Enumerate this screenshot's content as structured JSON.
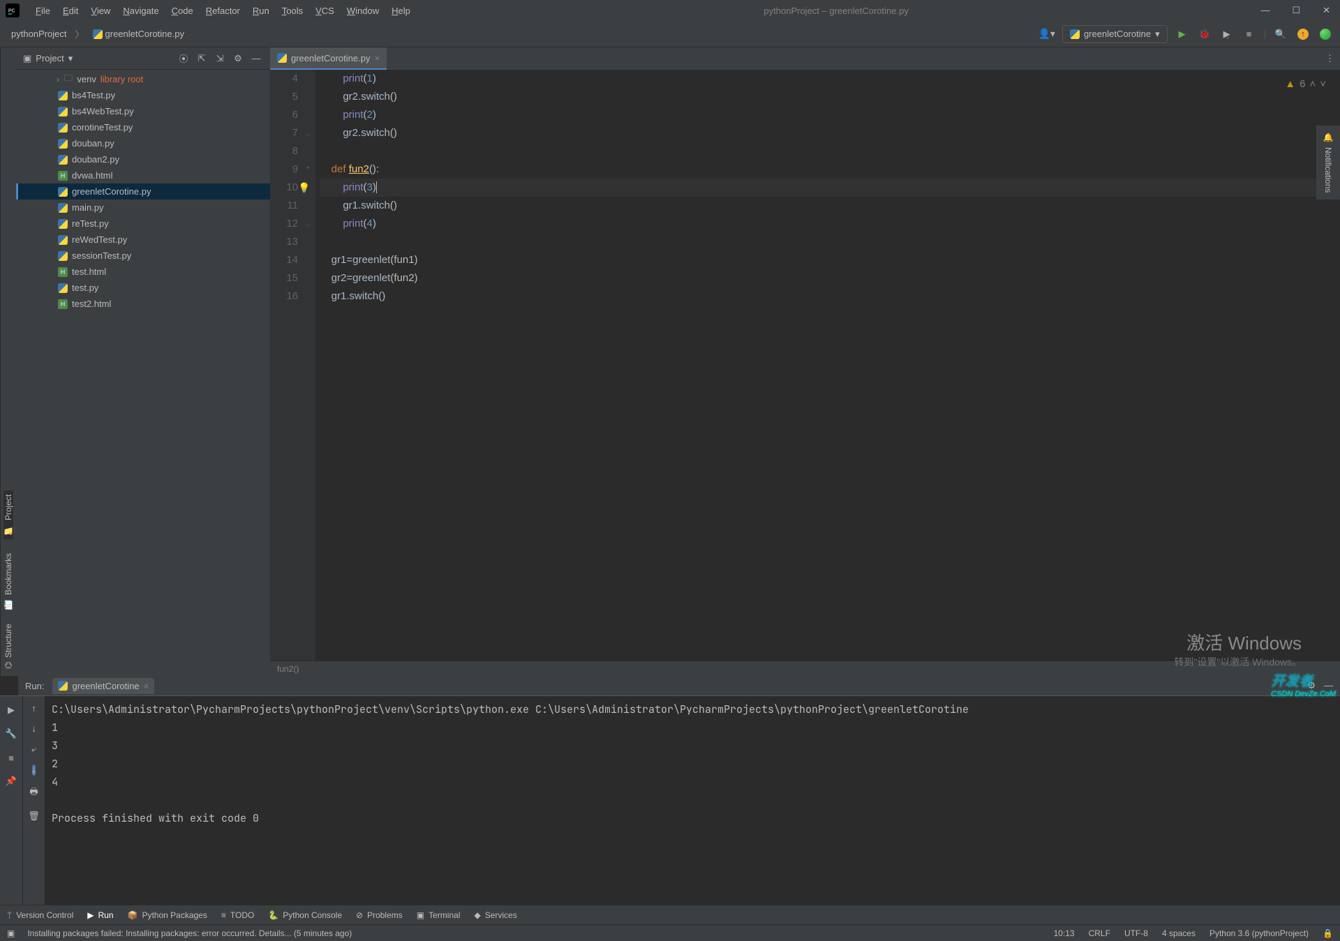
{
  "title": "pythonProject – greenletCorotine.py",
  "menu": [
    "File",
    "Edit",
    "View",
    "Navigate",
    "Code",
    "Refactor",
    "Run",
    "Tools",
    "VCS",
    "Window",
    "Help"
  ],
  "breadcrumb": [
    {
      "label": "pythonProject",
      "icon": ""
    },
    {
      "label": "greenletCorotine.py",
      "icon": "py"
    }
  ],
  "run_config": {
    "icon": "py",
    "label": "greenletCorotine"
  },
  "project_panel": {
    "title": "Project",
    "venv_label": "venv",
    "venv_tag": "library root",
    "files": [
      {
        "name": "bs4Test.py",
        "icon": "py"
      },
      {
        "name": "bs4WebTest.py",
        "icon": "py"
      },
      {
        "name": "corotineTest.py",
        "icon": "py"
      },
      {
        "name": "douban.py",
        "icon": "py"
      },
      {
        "name": "douban2.py",
        "icon": "py"
      },
      {
        "name": "dvwa.html",
        "icon": "html"
      },
      {
        "name": "greenletCorotine.py",
        "icon": "py",
        "selected": true
      },
      {
        "name": "main.py",
        "icon": "py"
      },
      {
        "name": "reTest.py",
        "icon": "py"
      },
      {
        "name": "reWedTest.py",
        "icon": "py"
      },
      {
        "name": "sessionTest.py",
        "icon": "py"
      },
      {
        "name": "test.html",
        "icon": "html"
      },
      {
        "name": "test.py",
        "icon": "py"
      },
      {
        "name": "test2.html",
        "icon": "html"
      }
    ]
  },
  "sidebar_tabs": [
    "Project",
    "Bookmarks",
    "Structure"
  ],
  "editor": {
    "tab_label": "greenletCorotine.py",
    "inspection_count": "6",
    "breadcrumb": "fun2()",
    "lines": [
      4,
      5,
      6,
      7,
      8,
      9,
      10,
      11,
      12,
      13,
      14,
      15,
      16
    ],
    "code_raw": [
      "        print(1)",
      "        gr2.switch()",
      "        print(2)",
      "        gr2.switch()",
      "",
      "    def fun2():",
      "        print(3)",
      "        gr1.switch()",
      "        print(4)",
      "",
      "    gr1=greenlet(fun1)",
      "    gr2=greenlet(fun2)",
      "    gr1.switch()"
    ]
  },
  "run_panel": {
    "label": "Run:",
    "tab_label": "greenletCorotine",
    "output": [
      "C:\\Users\\Administrator\\PycharmProjects\\pythonProject\\venv\\Scripts\\python.exe C:\\Users\\Administrator\\PycharmProjects\\pythonProject\\greenletCorotine",
      "1",
      "3",
      "2",
      "4",
      "",
      "Process finished with exit code 0"
    ]
  },
  "bottom_tabs": [
    {
      "label": "Version Control",
      "icon": "ᛘ"
    },
    {
      "label": "Run",
      "icon": "▶",
      "active": true
    },
    {
      "label": "Python Packages",
      "icon": "📦"
    },
    {
      "label": "TODO",
      "icon": "≡"
    },
    {
      "label": "Python Console",
      "icon": "🐍"
    },
    {
      "label": "Problems",
      "icon": "⊘"
    },
    {
      "label": "Terminal",
      "icon": "▣"
    },
    {
      "label": "Services",
      "icon": "◆"
    }
  ],
  "status": {
    "message": "Installing packages failed: Installing packages: error occurred. Details... (5 minutes ago)",
    "time": "10:13",
    "eol": "CRLF",
    "encoding": "UTF-8",
    "indent": "4 spaces",
    "interpreter": "Python 3.6 (pythonProject)"
  },
  "watermark": {
    "big": "激活 Windows",
    "small": "转到\"设置\"以激活 Windows。"
  },
  "corner": {
    "top": "开发者",
    "bottom": "CSDN DevZe.CoM"
  },
  "notifications_label": "Notifications"
}
